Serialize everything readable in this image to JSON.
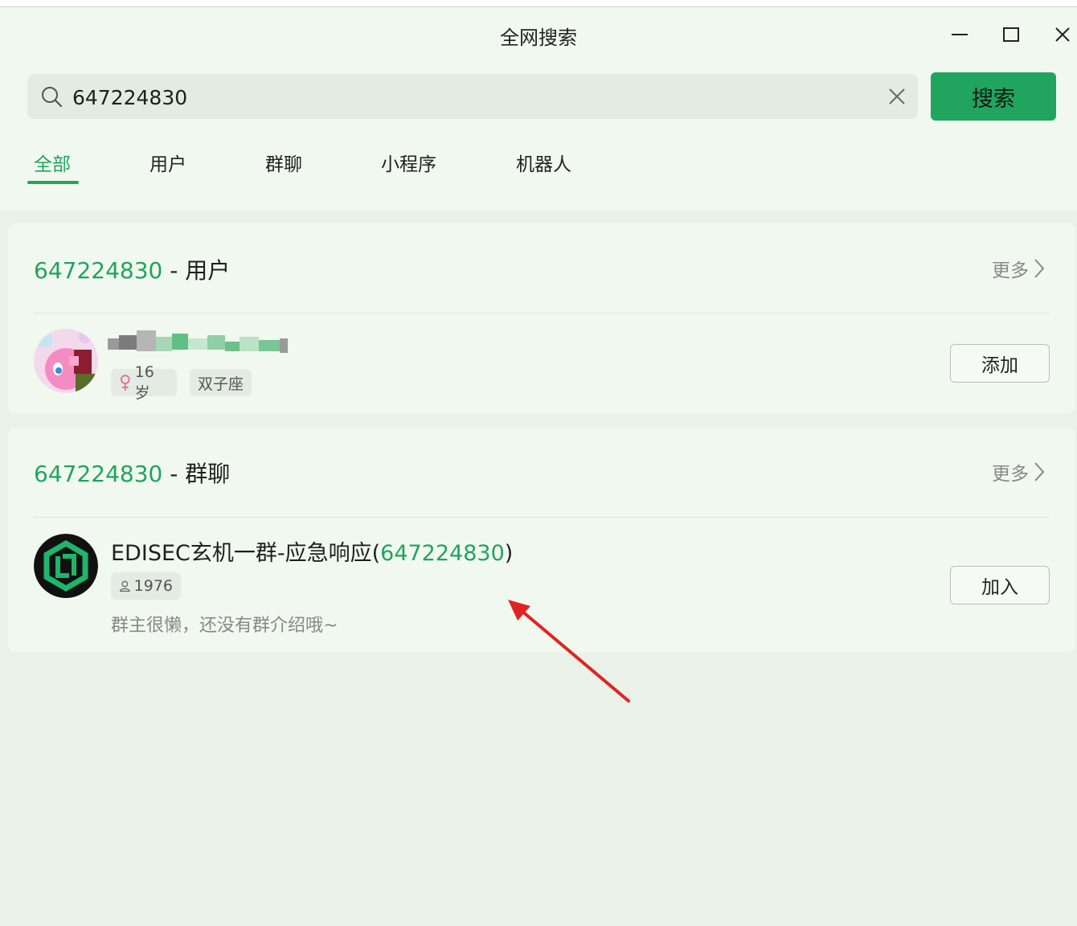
{
  "window": {
    "title": "全网搜索",
    "controls": [
      "minimize-icon",
      "maximize-icon",
      "close-icon"
    ]
  },
  "search": {
    "value": "647224830",
    "button_label": "搜索"
  },
  "tabs": [
    {
      "label": "全部",
      "active": true
    },
    {
      "label": "用户",
      "active": false
    },
    {
      "label": "群聊",
      "active": false
    },
    {
      "label": "小程序",
      "active": false
    },
    {
      "label": "机器人",
      "active": false
    }
  ],
  "user_section": {
    "keyword": "647224830",
    "heading_suffix": " - 用户",
    "more_label": "更多",
    "result": {
      "age_tag": "16岁",
      "gender_icon": "female-icon",
      "zodiac_tag": "双子座",
      "action_label": "添加"
    }
  },
  "group_section": {
    "keyword": "647224830",
    "heading_suffix": " - 群聊",
    "more_label": "更多",
    "result": {
      "name_prefix": "EDISEC玄机一群-应急响应(",
      "name_id": "647224830",
      "name_suffix": ")",
      "member_count": "1976",
      "description": "群主很懒，还没有群介绍哦~",
      "action_label": "加入"
    }
  },
  "colors": {
    "accent": "#21a45e",
    "annotation_arrow": "#e02424"
  }
}
